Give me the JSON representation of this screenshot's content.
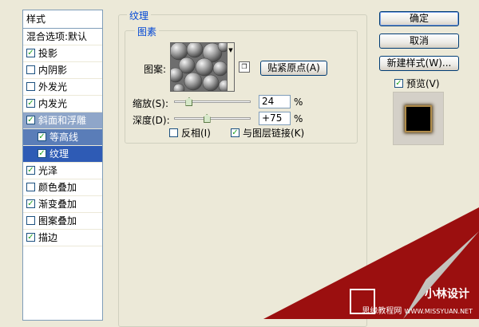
{
  "styles_panel": {
    "header": "样式",
    "items": [
      {
        "label": "混合选项:默认",
        "checkbox": false,
        "checked": false,
        "state": "plain"
      },
      {
        "label": "投影",
        "checkbox": true,
        "checked": true,
        "state": "normal"
      },
      {
        "label": "内阴影",
        "checkbox": true,
        "checked": false,
        "state": "normal"
      },
      {
        "label": "外发光",
        "checkbox": true,
        "checked": false,
        "state": "normal"
      },
      {
        "label": "内发光",
        "checkbox": true,
        "checked": true,
        "state": "normal"
      },
      {
        "label": "斜面和浮雕",
        "checkbox": true,
        "checked": true,
        "state": "parent-selected"
      },
      {
        "label": "等高线",
        "checkbox": true,
        "checked": true,
        "state": "sub"
      },
      {
        "label": "纹理",
        "checkbox": true,
        "checked": true,
        "state": "sub-active"
      },
      {
        "label": "光泽",
        "checkbox": true,
        "checked": true,
        "state": "normal"
      },
      {
        "label": "颜色叠加",
        "checkbox": true,
        "checked": false,
        "state": "normal"
      },
      {
        "label": "渐变叠加",
        "checkbox": true,
        "checked": true,
        "state": "normal"
      },
      {
        "label": "图案叠加",
        "checkbox": true,
        "checked": false,
        "state": "normal"
      },
      {
        "label": "描边",
        "checkbox": true,
        "checked": true,
        "state": "normal"
      }
    ]
  },
  "texture": {
    "group_title": "纹理",
    "elements_title": "图素",
    "pattern_label": "图案:",
    "snap_button": "贴紧原点(A)",
    "scale_label": "缩放(S):",
    "scale_value": "24",
    "scale_unit": "%",
    "scale_level": 24,
    "depth_label": "深度(D):",
    "depth_value": "+75",
    "depth_unit": "%",
    "depth_level": 75,
    "invert_label": "反相(I)",
    "invert_checked": false,
    "link_label": "与图层链接(K)",
    "link_checked": true
  },
  "actions": {
    "ok": "确定",
    "cancel": "取消",
    "new_style": "新建样式(W)...",
    "preview_label": "预览(V)",
    "preview_checked": true
  },
  "watermark": {
    "logo_text": "小林设计",
    "site_name": "思缘教程网",
    "site_url": "WWW.MISSYUAN.NET"
  },
  "colors": {
    "accent": "#0046D5",
    "selection": "#2E5BB5",
    "curl_red": "#9B0F0F"
  },
  "icons": {
    "pattern_dropdown": "triangle-down-icon",
    "new_preset": "new-preset-icon",
    "checkbox": "checkmark-icon"
  }
}
